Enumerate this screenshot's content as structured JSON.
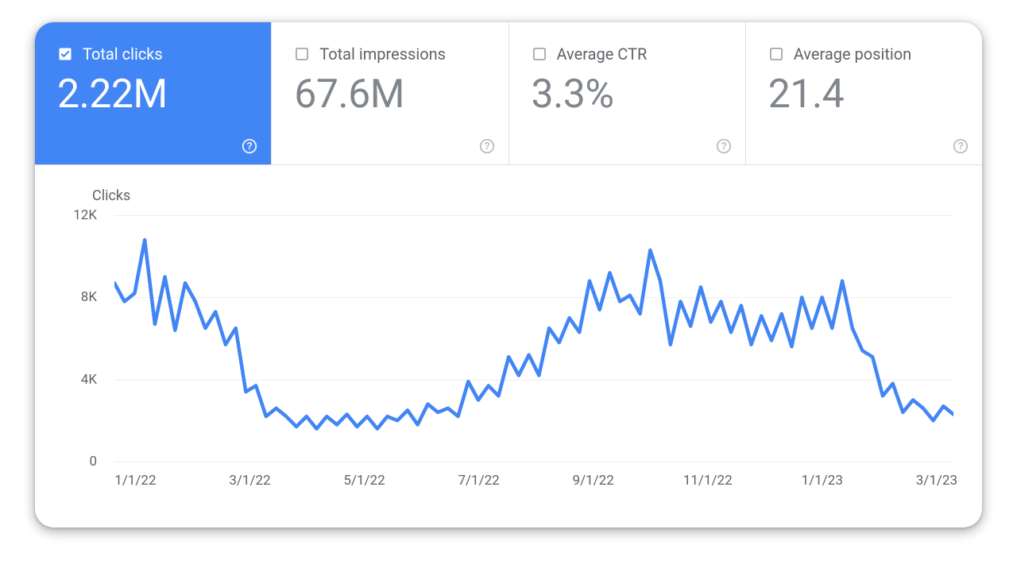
{
  "metrics": [
    {
      "key": "clicks",
      "label": "Total clicks",
      "value": "2.22M",
      "checked": true
    },
    {
      "key": "impressions",
      "label": "Total impressions",
      "value": "67.6M",
      "checked": false
    },
    {
      "key": "ctr",
      "label": "Average CTR",
      "value": "3.3%",
      "checked": false
    },
    {
      "key": "position",
      "label": "Average position",
      "value": "21.4",
      "checked": false
    }
  ],
  "chart_data": {
    "type": "line",
    "title": "Clicks",
    "ylabel": "Clicks",
    "ylim": [
      0,
      12000
    ],
    "yticks": [
      0,
      4000,
      8000,
      12000
    ],
    "ytick_labels": [
      "0",
      "4K",
      "8K",
      "12K"
    ],
    "x_major_ticks": [
      "1/1/22",
      "3/1/22",
      "5/1/22",
      "7/1/22",
      "9/1/22",
      "11/1/22",
      "1/1/23",
      "3/1/23"
    ],
    "series": [
      {
        "name": "Clicks",
        "values": [
          8700,
          7800,
          8200,
          10800,
          6700,
          9000,
          6400,
          8700,
          7800,
          6500,
          7300,
          5700,
          6500,
          3400,
          3700,
          2200,
          2600,
          2200,
          1700,
          2200,
          1600,
          2200,
          1800,
          2300,
          1700,
          2200,
          1600,
          2200,
          2000,
          2500,
          1800,
          2800,
          2400,
          2600,
          2200,
          3900,
          3000,
          3700,
          3200,
          5100,
          4200,
          5200,
          4200,
          6500,
          5800,
          7000,
          6300,
          8800,
          7400,
          9200,
          7800,
          8100,
          7200,
          10300,
          8800,
          5700,
          7800,
          6600,
          8500,
          6800,
          7800,
          6300,
          7600,
          5700,
          7100,
          5900,
          7200,
          5600,
          8000,
          6500,
          8000,
          6500,
          8800,
          6500,
          5400,
          5100,
          3200,
          3800,
          2400,
          3000,
          2600,
          2000,
          2700,
          2300
        ]
      }
    ]
  }
}
